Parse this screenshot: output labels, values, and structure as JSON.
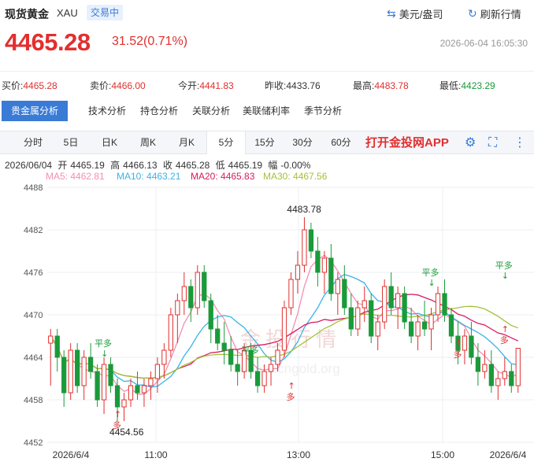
{
  "header": {
    "title": "现货黄金",
    "symbol": "XAU",
    "status": "交易中",
    "unit_link": "美元/盎司",
    "refresh_link": "刷新行情",
    "unit_icon": "swap-arrows-icon",
    "refresh_icon": "refresh-icon"
  },
  "quote": {
    "price": "4465.28",
    "change": "31.52(0.71%)",
    "datetime": "2026-06-04 16:05:30"
  },
  "stats": {
    "bid_label": "买价:",
    "bid": "4465.28",
    "ask_label": "卖价:",
    "ask": "4466.00",
    "open_label": "今开:",
    "open": "4441.83",
    "prev_label": "昨收:",
    "prev": "4433.76",
    "high_label": "最高:",
    "high": "4483.78",
    "low_label": "最低:",
    "low": "4423.29"
  },
  "tabs": [
    "贵金属分析",
    "技术分析",
    "持仓分析",
    "关联分析",
    "美联储利率",
    "季节分析"
  ],
  "periods": [
    "分时",
    "5日",
    "日K",
    "周K",
    "月K",
    "5分",
    "15分",
    "30分",
    "60分"
  ],
  "active_period": "5分",
  "app_link": "打开金投网APP",
  "toolbar_icons": [
    "settings-icon",
    "fullscreen-icon",
    "more-icon"
  ],
  "candle_info": {
    "date": "2026/06/04",
    "open_label": "开",
    "open": "4465.19",
    "high_label": "高",
    "high": "4466.13",
    "close_label": "收",
    "close": "4465.28",
    "low_label": "低",
    "low": "4465.19",
    "amp_label": "幅",
    "amp": "-0.00%"
  },
  "ma_legend": {
    "ma5": "MA5: 4462.81",
    "ma10": "MA10: 4463.21",
    "ma20": "MA20: 4465.83",
    "ma30": "MA30: 4467.56"
  },
  "colors": {
    "up": "#e12f2f",
    "down": "#1a9a3a",
    "accent": "#3a7bd5",
    "ma5": "#f28fb0",
    "ma10": "#3bb3e6",
    "ma20": "#d81b60",
    "ma30": "#a4c23a"
  },
  "watermark": "金投行情",
  "watermark_url": "quote.cngold.org",
  "chart_data": {
    "type": "candlestick",
    "y_ticks": [
      "4488",
      "4482",
      "4476",
      "4470",
      "4464",
      "4458",
      "4452"
    ],
    "ylim": [
      4452,
      4488
    ],
    "x_ticks": [
      "2026/6/4",
      "11:00",
      "13:00",
      "15:00",
      "2026/6/4"
    ],
    "annotations": {
      "max": "4483.78",
      "min": "4454.56",
      "flat": "平多",
      "long": "多"
    },
    "candles": [
      [
        4466,
        4468,
        4460,
        4467
      ],
      [
        4467,
        4468,
        4462,
        4464
      ],
      [
        4464,
        4465,
        4457,
        4459
      ],
      [
        4459,
        4466,
        4458,
        4465
      ],
      [
        4465,
        4466,
        4459,
        4460
      ],
      [
        4460,
        4465,
        4458,
        4464
      ],
      [
        4464,
        4466,
        4461,
        4462
      ],
      [
        4462,
        4463,
        4457,
        4458
      ],
      [
        4458,
        4464,
        4456,
        4463
      ],
      [
        4463,
        4464,
        4459,
        4460
      ],
      [
        4460,
        4461,
        4455,
        4457
      ],
      [
        4457,
        4459,
        4455,
        4458
      ],
      [
        4458,
        4461,
        4457,
        4460
      ],
      [
        4460,
        4462,
        4458,
        4459
      ],
      [
        4459,
        4461,
        4457,
        4460
      ],
      [
        4460,
        4462,
        4458,
        4461
      ],
      [
        4461,
        4464,
        4459,
        4463
      ],
      [
        4463,
        4466,
        4461,
        4465
      ],
      [
        4465,
        4471,
        4464,
        4470
      ],
      [
        4470,
        4473,
        4466,
        4472
      ],
      [
        4472,
        4476,
        4470,
        4474
      ],
      [
        4474,
        4475,
        4469,
        4471
      ],
      [
        4471,
        4477,
        4470,
        4476
      ],
      [
        4476,
        4477,
        4471,
        4472
      ],
      [
        4472,
        4473,
        4466,
        4468
      ],
      [
        4468,
        4470,
        4465,
        4466
      ],
      [
        4466,
        4469,
        4463,
        4465
      ],
      [
        4465,
        4467,
        4462,
        4463
      ],
      [
        4463,
        4465,
        4460,
        4462
      ],
      [
        4462,
        4466,
        4461,
        4465
      ],
      [
        4465,
        4466,
        4461,
        4462
      ],
      [
        4462,
        4464,
        4459,
        4460
      ],
      [
        4460,
        4463,
        4459,
        4462
      ],
      [
        4462,
        4464,
        4460,
        4463
      ],
      [
        4463,
        4466,
        4462,
        4465
      ],
      [
        4465,
        4472,
        4464,
        4471
      ],
      [
        4471,
        4476,
        4470,
        4475
      ],
      [
        4475,
        4479,
        4473,
        4477
      ],
      [
        4477,
        4483.78,
        4476,
        4482
      ],
      [
        4482,
        4483,
        4478,
        4479
      ],
      [
        4479,
        4481,
        4474,
        4476
      ],
      [
        4476,
        4479,
        4473,
        4478
      ],
      [
        4478,
        4480,
        4472,
        4473
      ],
      [
        4473,
        4476,
        4470,
        4475
      ],
      [
        4475,
        4477,
        4470,
        4471
      ],
      [
        4471,
        4473,
        4467,
        4468
      ],
      [
        4468,
        4472,
        4467,
        4471
      ],
      [
        4471,
        4474,
        4469,
        4472
      ],
      [
        4472,
        4473,
        4466,
        4467
      ],
      [
        4467,
        4470,
        4465,
        4469
      ],
      [
        4469,
        4475,
        4468,
        4474
      ],
      [
        4474,
        4476,
        4470,
        4471
      ],
      [
        4471,
        4474,
        4468,
        4473
      ],
      [
        4473,
        4474,
        4468,
        4469
      ],
      [
        4469,
        4471,
        4466,
        4467
      ],
      [
        4467,
        4470,
        4465,
        4469
      ],
      [
        4469,
        4472,
        4467,
        4468
      ],
      [
        4468,
        4471,
        4465,
        4470
      ],
      [
        4470,
        4474,
        4469,
        4473
      ],
      [
        4473,
        4475,
        4469,
        4470
      ],
      [
        4470,
        4471,
        4466,
        4467
      ],
      [
        4467,
        4469,
        4463,
        4465
      ],
      [
        4465,
        4468,
        4463,
        4467
      ],
      [
        4467,
        4469,
        4463,
        4464
      ],
      [
        4464,
        4466,
        4460,
        4462
      ],
      [
        4462,
        4465,
        4461,
        4463
      ],
      [
        4463,
        4465,
        4459,
        4460
      ],
      [
        4460,
        4462,
        4458,
        4461
      ],
      [
        4461,
        4464,
        4460,
        4462
      ],
      [
        4462,
        4463,
        4459,
        4460
      ],
      [
        4460,
        4465.2,
        4459,
        4465.28
      ]
    ]
  }
}
